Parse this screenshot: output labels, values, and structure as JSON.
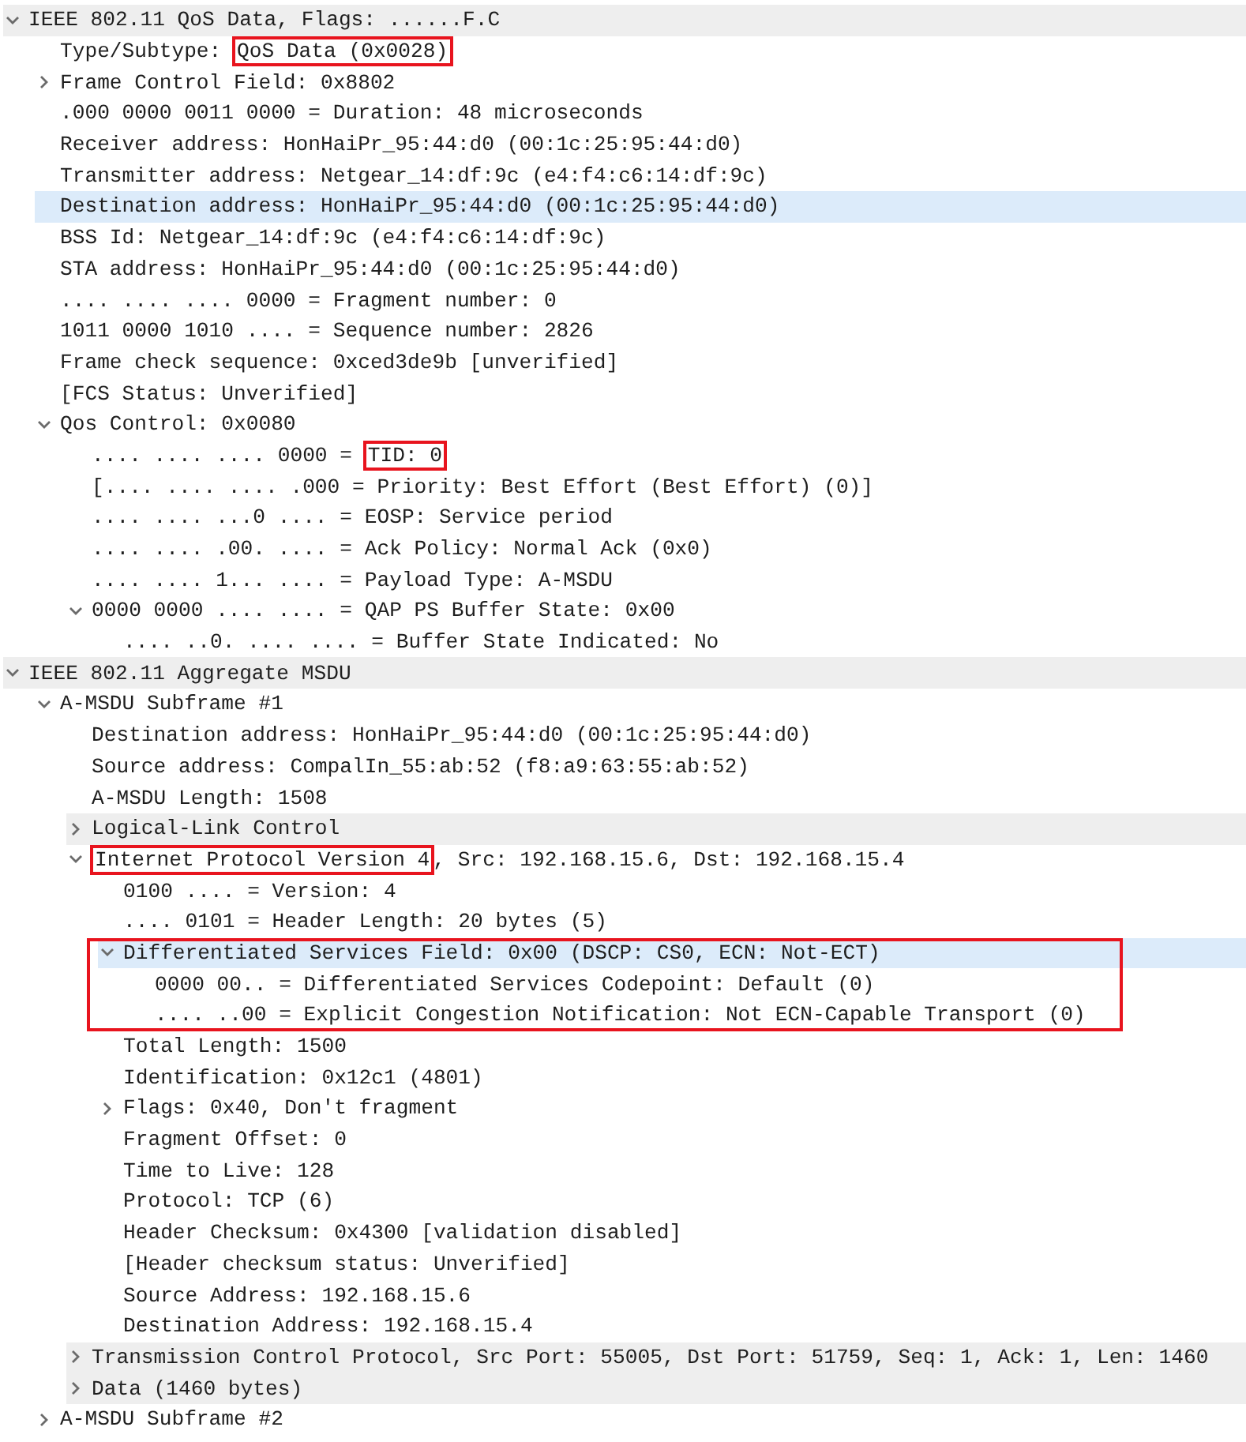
{
  "tree": [
    {
      "kind": "branch",
      "expanded": true,
      "selected": false,
      "protocol": true,
      "parts": [
        {
          "text": "IEEE 802.11 QoS Data, Flags: ......F.C"
        }
      ],
      "children": [
        {
          "kind": "leaf",
          "selected": false,
          "protocol": false,
          "parts": [
            {
              "text": "Type/Subtype: "
            },
            {
              "text": "QoS Data (0x0028)",
              "boxed": true
            }
          ]
        },
        {
          "kind": "branch",
          "expanded": false,
          "selected": false,
          "protocol": false,
          "parts": [
            {
              "text": "Frame Control Field: 0x8802"
            }
          ]
        },
        {
          "kind": "leaf",
          "selected": false,
          "protocol": false,
          "parts": [
            {
              "text": ".000 0000 0011 0000 = Duration: 48 microseconds"
            }
          ]
        },
        {
          "kind": "leaf",
          "selected": false,
          "protocol": false,
          "parts": [
            {
              "text": "Receiver address: HonHaiPr_95:44:d0 (00:1c:25:95:44:d0)"
            }
          ]
        },
        {
          "kind": "leaf",
          "selected": false,
          "protocol": false,
          "parts": [
            {
              "text": "Transmitter address: Netgear_14:df:9c (e4:f4:c6:14:df:9c)"
            }
          ]
        },
        {
          "kind": "leaf",
          "selected": true,
          "protocol": false,
          "parts": [
            {
              "text": "Destination address: HonHaiPr_95:44:d0 (00:1c:25:95:44:d0)"
            }
          ]
        },
        {
          "kind": "leaf",
          "selected": false,
          "protocol": false,
          "parts": [
            {
              "text": "BSS Id: Netgear_14:df:9c (e4:f4:c6:14:df:9c)"
            }
          ]
        },
        {
          "kind": "leaf",
          "selected": false,
          "protocol": false,
          "parts": [
            {
              "text": "STA address: HonHaiPr_95:44:d0 (00:1c:25:95:44:d0)"
            }
          ]
        },
        {
          "kind": "leaf",
          "selected": false,
          "protocol": false,
          "parts": [
            {
              "text": ".... .... .... 0000 = Fragment number: 0"
            }
          ]
        },
        {
          "kind": "leaf",
          "selected": false,
          "protocol": false,
          "parts": [
            {
              "text": "1011 0000 1010 .... = Sequence number: 2826"
            }
          ]
        },
        {
          "kind": "leaf",
          "selected": false,
          "protocol": false,
          "parts": [
            {
              "text": "Frame check sequence: 0xced3de9b [unverified]"
            }
          ]
        },
        {
          "kind": "leaf",
          "selected": false,
          "protocol": false,
          "parts": [
            {
              "text": "[FCS Status: Unverified]"
            }
          ]
        },
        {
          "kind": "branch",
          "expanded": true,
          "selected": false,
          "protocol": false,
          "parts": [
            {
              "text": "Qos Control: 0x0080"
            }
          ],
          "children": [
            {
              "kind": "leaf",
              "selected": false,
              "protocol": false,
              "parts": [
                {
                  "text": ".... .... .... 0000 = "
                },
                {
                  "text": "TID: 0",
                  "boxed": true
                }
              ]
            },
            {
              "kind": "leaf",
              "selected": false,
              "protocol": false,
              "parts": [
                {
                  "text": "[.... .... .... .000 = Priority: Best Effort (Best Effort) (0)]"
                }
              ]
            },
            {
              "kind": "leaf",
              "selected": false,
              "protocol": false,
              "parts": [
                {
                  "text": ".... .... ...0 .... = EOSP: Service period"
                }
              ]
            },
            {
              "kind": "leaf",
              "selected": false,
              "protocol": false,
              "parts": [
                {
                  "text": ".... .... .00. .... = Ack Policy: Normal Ack (0x0)"
                }
              ]
            },
            {
              "kind": "leaf",
              "selected": false,
              "protocol": false,
              "parts": [
                {
                  "text": ".... .... 1... .... = Payload Type: A-MSDU"
                }
              ]
            },
            {
              "kind": "branch",
              "expanded": true,
              "selected": false,
              "protocol": false,
              "parts": [
                {
                  "text": "0000 0000 .... .... = QAP PS Buffer State: 0x00"
                }
              ],
              "children": [
                {
                  "kind": "leaf",
                  "selected": false,
                  "protocol": false,
                  "parts": [
                    {
                      "text": ".... ..0. .... .... = Buffer State Indicated: No"
                    }
                  ]
                }
              ]
            }
          ]
        }
      ]
    },
    {
      "kind": "branch",
      "expanded": true,
      "selected": false,
      "protocol": true,
      "parts": [
        {
          "text": "IEEE 802.11 Aggregate MSDU"
        }
      ],
      "children": [
        {
          "kind": "branch",
          "expanded": true,
          "selected": false,
          "protocol": false,
          "parts": [
            {
              "text": "A-MSDU Subframe #1"
            }
          ],
          "children": [
            {
              "kind": "leaf",
              "selected": false,
              "protocol": false,
              "parts": [
                {
                  "text": "Destination address: HonHaiPr_95:44:d0 (00:1c:25:95:44:d0)"
                }
              ]
            },
            {
              "kind": "leaf",
              "selected": false,
              "protocol": false,
              "parts": [
                {
                  "text": "Source address: CompalIn_55:ab:52 (f8:a9:63:55:ab:52)"
                }
              ]
            },
            {
              "kind": "leaf",
              "selected": false,
              "protocol": false,
              "parts": [
                {
                  "text": "A-MSDU Length: 1508"
                }
              ]
            },
            {
              "kind": "branch",
              "expanded": false,
              "selected": false,
              "protocol": true,
              "parts": [
                {
                  "text": "Logical-Link Control"
                }
              ]
            },
            {
              "kind": "branch",
              "expanded": true,
              "selected": false,
              "protocol": false,
              "parts": [
                {
                  "text": "Internet Protocol Version 4",
                  "boxed": true
                },
                {
                  "text": ", Src: 192.168.15.6, Dst: 192.168.15.4"
                }
              ],
              "children": [
                {
                  "kind": "leaf",
                  "selected": false,
                  "protocol": false,
                  "parts": [
                    {
                      "text": "0100 .... = Version: 4"
                    }
                  ]
                },
                {
                  "kind": "leaf",
                  "selected": false,
                  "protocol": false,
                  "parts": [
                    {
                      "text": ".... 0101 = Header Length: 20 bytes (5)"
                    }
                  ]
                },
                {
                  "kind": "branch",
                  "expanded": true,
                  "selected": true,
                  "protocol": false,
                  "boxed": true,
                  "parts": [
                    {
                      "text": "Differentiated Services Field: 0x00 (DSCP: CS0, ECN: Not-ECT)"
                    }
                  ],
                  "children": [
                    {
                      "kind": "leaf",
                      "selected": false,
                      "protocol": false,
                      "parts": [
                        {
                          "text": "0000 00.. = Differentiated Services Codepoint: Default (0)"
                        }
                      ]
                    },
                    {
                      "kind": "leaf",
                      "selected": false,
                      "protocol": false,
                      "parts": [
                        {
                          "text": ".... ..00 = Explicit Congestion Notification: Not ECN-Capable Transport (0)"
                        }
                      ]
                    }
                  ]
                },
                {
                  "kind": "leaf",
                  "selected": false,
                  "protocol": false,
                  "parts": [
                    {
                      "text": "Total Length: 1500"
                    }
                  ]
                },
                {
                  "kind": "leaf",
                  "selected": false,
                  "protocol": false,
                  "parts": [
                    {
                      "text": "Identification: 0x12c1 (4801)"
                    }
                  ]
                },
                {
                  "kind": "branch",
                  "expanded": false,
                  "selected": false,
                  "protocol": false,
                  "parts": [
                    {
                      "text": "Flags: 0x40, Don't fragment"
                    }
                  ]
                },
                {
                  "kind": "leaf",
                  "selected": false,
                  "protocol": false,
                  "parts": [
                    {
                      "text": "Fragment Offset: 0"
                    }
                  ]
                },
                {
                  "kind": "leaf",
                  "selected": false,
                  "protocol": false,
                  "parts": [
                    {
                      "text": "Time to Live: 128"
                    }
                  ]
                },
                {
                  "kind": "leaf",
                  "selected": false,
                  "protocol": false,
                  "parts": [
                    {
                      "text": "Protocol: TCP (6)"
                    }
                  ]
                },
                {
                  "kind": "leaf",
                  "selected": false,
                  "protocol": false,
                  "parts": [
                    {
                      "text": "Header Checksum: 0x4300 [validation disabled]"
                    }
                  ]
                },
                {
                  "kind": "leaf",
                  "selected": false,
                  "protocol": false,
                  "parts": [
                    {
                      "text": "[Header checksum status: Unverified]"
                    }
                  ]
                },
                {
                  "kind": "leaf",
                  "selected": false,
                  "protocol": false,
                  "parts": [
                    {
                      "text": "Source Address: 192.168.15.6"
                    }
                  ]
                },
                {
                  "kind": "leaf",
                  "selected": false,
                  "protocol": false,
                  "parts": [
                    {
                      "text": "Destination Address: 192.168.15.4"
                    }
                  ]
                }
              ]
            },
            {
              "kind": "branch",
              "expanded": false,
              "selected": false,
              "protocol": true,
              "parts": [
                {
                  "text": "Transmission Control Protocol, Src Port: 55005, Dst Port: 51759, Seq: 1, Ack: 1, Len: 1460"
                }
              ]
            },
            {
              "kind": "branch",
              "expanded": false,
              "selected": false,
              "protocol": true,
              "parts": [
                {
                  "text": "Data (1460 bytes)"
                }
              ]
            }
          ]
        },
        {
          "kind": "branch",
          "expanded": false,
          "selected": false,
          "protocol": false,
          "parts": [
            {
              "text": "A-MSDU Subframe #2"
            }
          ]
        }
      ]
    }
  ]
}
